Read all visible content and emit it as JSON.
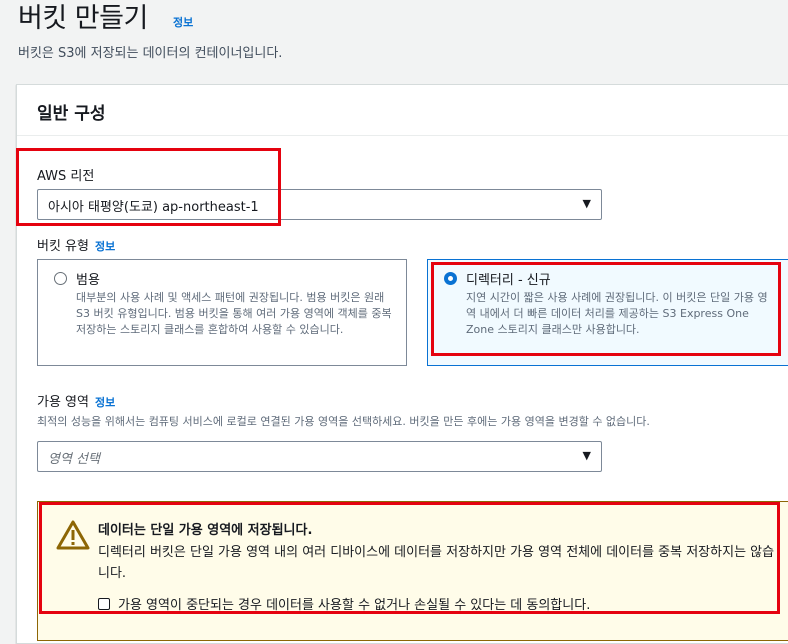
{
  "header": {
    "title": "버킷 만들기",
    "info": "정보",
    "description": "버킷은 S3에 저장되는 데이터의 컨테이너입니다."
  },
  "general": {
    "title": "일반 구성",
    "region": {
      "label": "AWS 리전",
      "value": "아시아 태평양(도쿄) ap-northeast-1"
    },
    "bucket_type": {
      "label": "버킷 유형",
      "info": "정보",
      "options": [
        {
          "title": "범용",
          "description": "대부분의 사용 사례 및 액세스 패턴에 권장됩니다. 범용 버킷은 원래 S3 버킷 유형입니다. 범용 버킷을 통해 여러 가용 영역에 객체를 중복 저장하는 스토리지 클래스를 혼합하여 사용할 수 있습니다.",
          "selected": false
        },
        {
          "title": "디렉터리 - 신규",
          "description": "지연 시간이 짧은 사용 사례에 권장됩니다. 이 버킷은 단일 가용 영역 내에서 더 빠른 데이터 처리를 제공하는 S3 Express One Zone 스토리지 클래스만 사용합니다.",
          "selected": true
        }
      ]
    },
    "availability_zone": {
      "label": "가용 영역",
      "info": "정보",
      "description": "최적의 성능을 위해서는 컴퓨팅 서비스에 로컬로 연결된 가용 영역을 선택하세요. 버킷을 만든 후에는 가용 영역을 변경할 수 없습니다.",
      "placeholder": "영역 선택"
    },
    "warning": {
      "title": "데이터는 단일 가용 영역에 저장됩니다.",
      "body": "디렉터리 버킷은 단일 가용 영역 내의 여러 디바이스에 데이터를 저장하지만 가용 영역 전체에 데이터를 중복 저장하지는 않습니다.",
      "checkbox_label": "가용 영역이 중단되는 경우 데이터를 사용할 수 없거나 손실될 수 있다는 데 동의합니다.",
      "checked": false
    }
  },
  "colors": {
    "accent": "#0972d3",
    "highlight": "#e5020f",
    "warning_bg": "#fffce9",
    "warning_icon": "#8d6605"
  }
}
